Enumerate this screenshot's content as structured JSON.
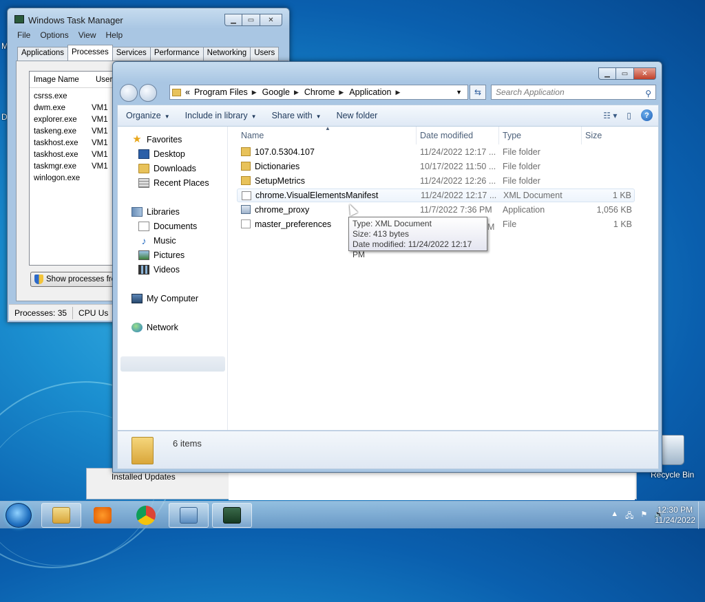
{
  "desktop": {
    "left_letters": [
      "M",
      "D"
    ],
    "background_window_label": "Installed Updates",
    "recycle_bin_label": "Recycle Bin"
  },
  "task_manager": {
    "title": "Windows Task Manager",
    "menu": [
      "File",
      "Options",
      "View",
      "Help"
    ],
    "tabs": [
      "Applications",
      "Processes",
      "Services",
      "Performance",
      "Networking",
      "Users"
    ],
    "active_tab": "Processes",
    "columns": [
      "Image Name",
      "User"
    ],
    "processes": [
      {
        "name": "csrss.exe",
        "user": ""
      },
      {
        "name": "dwm.exe",
        "user": "VM1"
      },
      {
        "name": "explorer.exe",
        "user": "VM1"
      },
      {
        "name": "taskeng.exe",
        "user": "VM1"
      },
      {
        "name": "taskhost.exe",
        "user": "VM1"
      },
      {
        "name": "taskhost.exe",
        "user": "VM1"
      },
      {
        "name": "taskmgr.exe",
        "user": "VM1"
      },
      {
        "name": "winlogon.exe",
        "user": ""
      }
    ],
    "show_button": "Show processes from",
    "status": [
      "Processes: 35",
      "CPU Us"
    ]
  },
  "explorer": {
    "address": {
      "prefix": "«",
      "crumbs": [
        "Program Files",
        "Google",
        "Chrome",
        "Application"
      ]
    },
    "search_placeholder": "Search Application",
    "commands": {
      "organize": "Organize",
      "include": "Include in library",
      "share": "Share with",
      "new_folder": "New folder"
    },
    "nav": {
      "favorites": "Favorites",
      "desktop": "Desktop",
      "downloads": "Downloads",
      "recent": "Recent Places",
      "libraries": "Libraries",
      "documents": "Documents",
      "music": "Music",
      "pictures": "Pictures",
      "videos": "Videos",
      "computer": "My Computer",
      "network": "Network"
    },
    "columns": {
      "name": "Name",
      "date": "Date modified",
      "type": "Type",
      "size": "Size"
    },
    "files": [
      {
        "name": "107.0.5304.107",
        "date": "11/24/2022 12:17 ...",
        "type": "File folder",
        "size": "",
        "icon": "folder"
      },
      {
        "name": "Dictionaries",
        "date": "10/17/2022 11:50 ...",
        "type": "File folder",
        "size": "",
        "icon": "folder"
      },
      {
        "name": "SetupMetrics",
        "date": "11/24/2022 12:26 ...",
        "type": "File folder",
        "size": "",
        "icon": "folder"
      },
      {
        "name": "chrome.VisualElementsManifest",
        "date": "11/24/2022 12:17 ...",
        "type": "XML Document",
        "size": "1 KB",
        "icon": "xml"
      },
      {
        "name": "chrome_proxy",
        "date": "11/7/2022 7:36 PM",
        "type": "Application",
        "size": "1,056 KB",
        "icon": "app"
      },
      {
        "name": "master_preferences",
        "date": "",
        "type": "File",
        "size": "1 KB",
        "icon": "file"
      }
    ],
    "tooltip": [
      "Type: XML Document",
      "Size: 413 bytes",
      "Date modified: 11/24/2022 12:17 PM"
    ],
    "tooltip_date_tail": "M",
    "item_count": "6 items"
  },
  "taskbar": {
    "time": "12:30 PM",
    "date": "11/24/2022"
  }
}
